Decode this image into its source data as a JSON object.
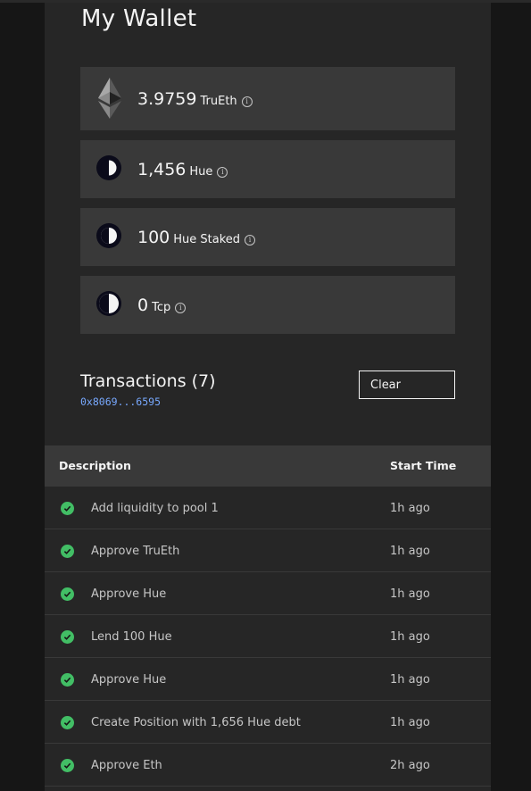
{
  "wallet": {
    "title": "My Wallet",
    "balances": [
      {
        "amount": "3.9759",
        "unit": "TruEth",
        "icon": "eth-icon",
        "info_glyph": "i"
      },
      {
        "amount": "1,456",
        "unit": "Hue",
        "icon": "hue-token-icon",
        "info_glyph": "i"
      },
      {
        "amount": "100",
        "unit": "Hue Staked",
        "icon": "hue-token-icon",
        "info_glyph": "i"
      },
      {
        "amount": "0",
        "unit": "Tcp",
        "icon": "tcp-token-icon",
        "info_glyph": "i"
      }
    ]
  },
  "transactions": {
    "heading": "Transactions (7)",
    "address": "0x8069...6595",
    "clear_label": "Clear",
    "columns": {
      "description": "Description",
      "start_time": "Start Time"
    },
    "rows": [
      {
        "description": "Add liquidity to pool 1",
        "time": "1h ago"
      },
      {
        "description": "Approve TruEth",
        "time": "1h ago"
      },
      {
        "description": "Approve Hue",
        "time": "1h ago"
      },
      {
        "description": "Lend 100 Hue",
        "time": "1h ago"
      },
      {
        "description": "Approve Hue",
        "time": "1h ago"
      },
      {
        "description": "Create Position with 1,656 Hue debt",
        "time": "1h ago"
      },
      {
        "description": "Approve Eth",
        "time": "2h ago"
      }
    ]
  },
  "colors": {
    "success": "#42be65",
    "link": "#78a9ff",
    "card": "#393939",
    "panel": "#262626"
  }
}
